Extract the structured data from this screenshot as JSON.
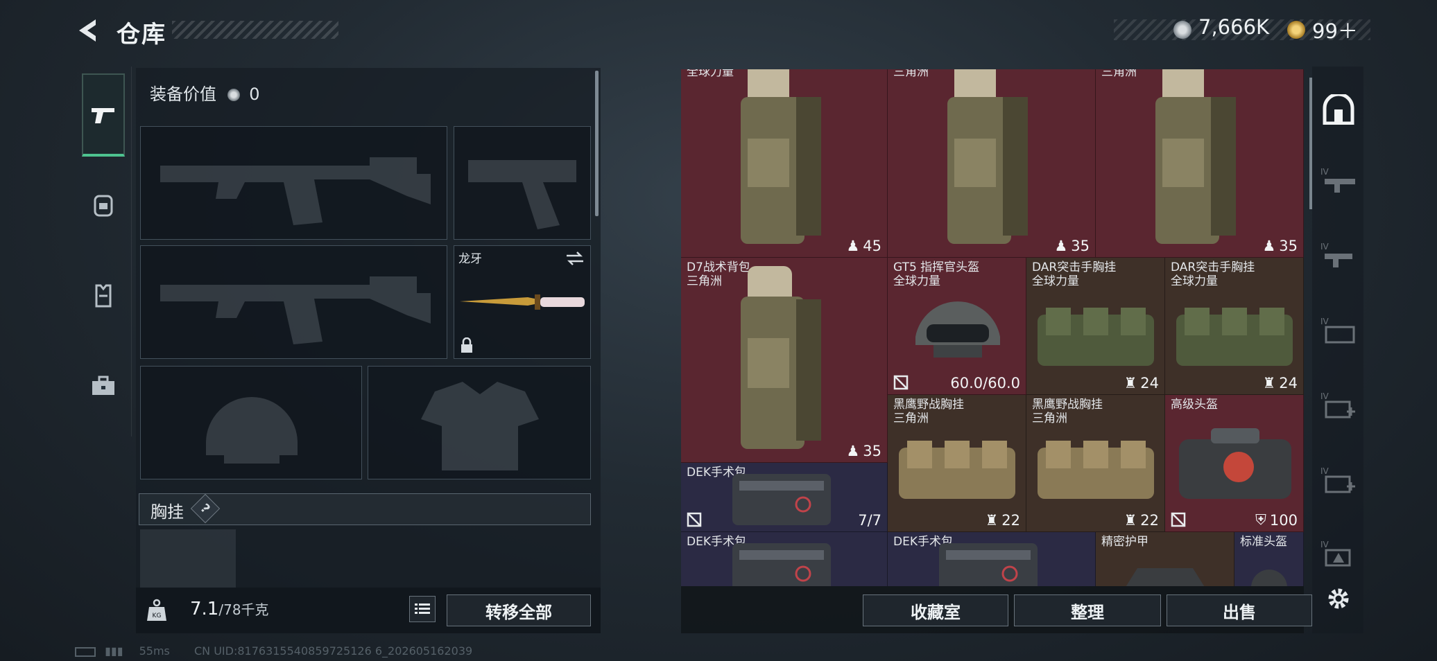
{
  "header": {
    "title": "仓库",
    "currency_a": "7,666K",
    "currency_b": "99＋"
  },
  "tabs": [
    {
      "icon": "pistol-icon",
      "active": true
    },
    {
      "icon": "backpack-icon"
    },
    {
      "icon": "vest-icon"
    },
    {
      "icon": "toolbox-icon"
    }
  ],
  "loadout": {
    "equip_value_label": "装备价值",
    "equip_value": "0",
    "melee_name": "龙牙",
    "chest_label": "胸挂",
    "help": "?",
    "weight_current": "7.1",
    "weight_max": "/78千克",
    "transfer_all": "转移全部"
  },
  "stash": {
    "row1": [
      {
        "name": "全球力量",
        "value": "45"
      },
      {
        "name": "三角洲",
        "value": "35"
      },
      {
        "name": "三角洲",
        "value": "35"
      }
    ],
    "d7": {
      "name": "D7战术背包",
      "sub": "三角洲",
      "value": "35"
    },
    "gt5": {
      "name": "GT5 指挥官头盔",
      "sub": "全球力量",
      "value": "60.0/60.0"
    },
    "dar1": {
      "name": "DAR突击手胸挂",
      "sub": "全球力量",
      "value": "24"
    },
    "dar2": {
      "name": "DAR突击手胸挂",
      "sub": "全球力量",
      "value": "24"
    },
    "eagle1": {
      "name": "黑鹰野战胸挂",
      "sub": "三角洲",
      "value": "22"
    },
    "eagle2": {
      "name": "黑鹰野战胸挂",
      "sub": "三角洲",
      "value": "22"
    },
    "helmet": {
      "name": "高级头盔",
      "value": "100"
    },
    "dek1": {
      "name": "DEK手术包",
      "value": "7/7"
    },
    "dek2": {
      "name": "DEK手术包"
    },
    "dek3": {
      "name": "DEK手术包"
    },
    "armor": {
      "name": "精密护甲"
    },
    "helmet2": {
      "name": "标准头盔"
    }
  },
  "actions": {
    "collection": "收藏室",
    "sort": "整理",
    "sell": "出售"
  },
  "footer": {
    "ping": "55ms",
    "uid": "CN UID:8176315540859725126 6_202605162039"
  },
  "colors": {
    "accent": "#4ec38f",
    "red_cell": "#5a2630",
    "brown_cell": "#3e3028",
    "purple_cell": "#2b2a44"
  }
}
